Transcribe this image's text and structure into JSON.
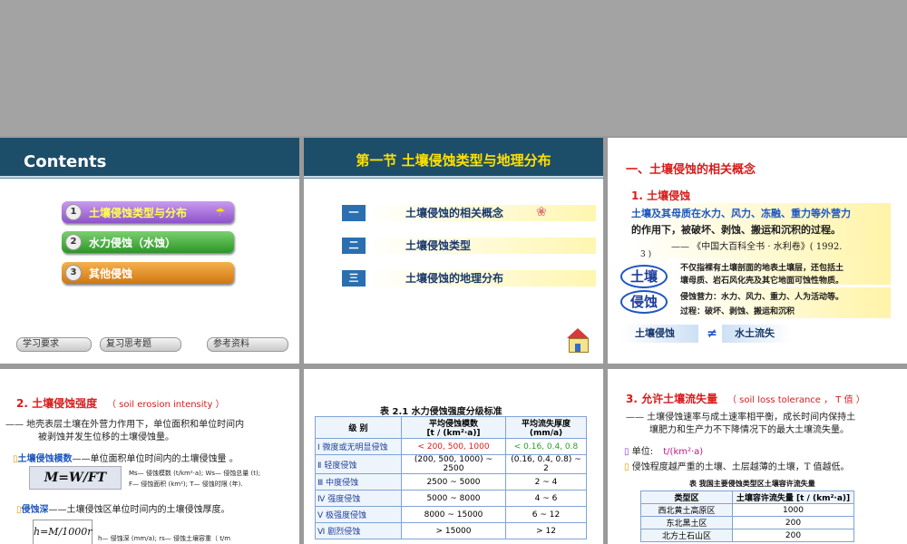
{
  "slide1": {
    "title": "Contents",
    "items": [
      {
        "num": "1",
        "label": "土壤侵蚀类型与分布"
      },
      {
        "num": "2",
        "label": "水力侵蚀（水蚀）"
      },
      {
        "num": "3",
        "label": "其他侵蚀"
      }
    ],
    "bottom": [
      "学习要求",
      "复习思考题",
      "参考资料"
    ]
  },
  "slide2": {
    "title": "第一节  土壤侵蚀类型与地理分布",
    "rows": [
      {
        "tag": "一",
        "label": "土壤侵蚀的相关概念"
      },
      {
        "tag": "二",
        "label": "土壤侵蚀类型"
      },
      {
        "tag": "三",
        "label": "土壤侵蚀的地理分布"
      }
    ]
  },
  "slide3": {
    "heading": "一、土壤侵蚀的相关概念",
    "sub": "1. 土壤侵蚀",
    "def_line1": "土壤及其母质在水力、风力、冻融、重力等外营力",
    "def_line2": "的作用下，被破坏、剥蚀、搬运和沉积的过程。",
    "cite": "—— 《中国大百科全书 · 水利卷》( 1992.",
    "cite_end": "3 )",
    "soil_word": "土壤",
    "soil_desc1": "不仅指裸有土壤剖面的地表土壤层，还包括土",
    "soil_desc2": "壤母质、岩石风化壳及其它地面可蚀性物质。",
    "erosion_word": "侵蚀",
    "erosion_desc1": "侵蚀营力：水力、风力、重力、人为活动等。",
    "erosion_desc2": "过程：破坏、剥蚀、搬运和沉积",
    "cmp_left": "土壤侵蚀",
    "cmp_sign": "≠",
    "cmp_right": "水土流失"
  },
  "slide4": {
    "heading": "2. 土壤侵蚀强度",
    "heading_en": "（ soil erosion intensity ）",
    "def1": "—— 地壳表层土壤在外营力作用下，单位面积和单位时间内",
    "def2": "被剥蚀并发生位移的土壤侵蚀量。",
    "mod_label": "土壤侵蚀模数",
    "mod_desc": "——单位面积单位时间内的土壤侵蚀量 。",
    "formula1_legend1": "Ms— 侵蚀模数 (t/km²·a); Ws— 侵蚀总量 (t);",
    "formula1_legend2": "F— 侵蚀面积 (km²); T— 侵蚀时限 (年).",
    "depth_label": "侵蚀深",
    "depth_desc": "——土壤侵蚀区单位时间内的土壤侵蚀厚度。",
    "formula2_legend": "h— 侵蚀深 (mm/a); rs— 侵蚀土壤容重（ t/m"
  },
  "slide5": {
    "caption": "表 2.1    水力侵蚀强度分级标准",
    "headers": [
      "级    别",
      "平均侵蚀模数\n[t / (km²·a)]",
      "平均流失厚度\n(mm/a)"
    ],
    "rows": [
      {
        "roman": "Ⅰ",
        "level": "微度或无明显侵蚀",
        "modulus": "< 200, 500, 1000",
        "depth": "< 0.16, 0.4, 0.8"
      },
      {
        "roman": "Ⅱ",
        "level": "轻度侵蚀",
        "modulus": "(200, 500, 1000) ~ 2500",
        "depth": "(0.16, 0.4, 0.8) ~ 2"
      },
      {
        "roman": "Ⅲ",
        "level": "中度侵蚀",
        "modulus": "2500 ~ 5000",
        "depth": "2 ~ 4"
      },
      {
        "roman": "Ⅳ",
        "level": "强度侵蚀",
        "modulus": "5000 ~ 8000",
        "depth": "4 ~ 6"
      },
      {
        "roman": "Ⅴ",
        "level": "极强度侵蚀",
        "modulus": "8000 ~ 15000",
        "depth": "6 ~ 12"
      },
      {
        "roman": "Ⅵ",
        "level": "剧烈侵蚀",
        "modulus": "> 15000",
        "depth": "> 12"
      }
    ]
  },
  "slide6": {
    "heading": "3. 允许土壤流失量",
    "heading_en": "（ soil loss tolerance ， T 值 ）",
    "def1": "——  土壤侵蚀速率与成土速率相平衡，成长时间内保持土",
    "def2": "壤肥力和生产力不下降情况下的最大土壤流失量。",
    "unit_label": "单位:",
    "unit_value": "t/(km²·a)",
    "note": "侵蚀程度越严重的土壤、土层越薄的土壤，T 值越低。",
    "table_caption": "表     我国主要侵蚀类型区土壤容许流失量",
    "headers": [
      "类型区",
      "土壤容许流失量 [t / (km²·a)]"
    ],
    "rows": [
      {
        "region": "西北黄土高原区",
        "value": "1000"
      },
      {
        "region": "东北黑土区",
        "value": "200"
      },
      {
        "region": "北方土石山区",
        "value": "200"
      }
    ]
  },
  "colors": {
    "header_bg": "#1d4e69",
    "accent_yellow": "#ffe000",
    "red": "#d81c1c",
    "blue": "#1e56c0"
  }
}
